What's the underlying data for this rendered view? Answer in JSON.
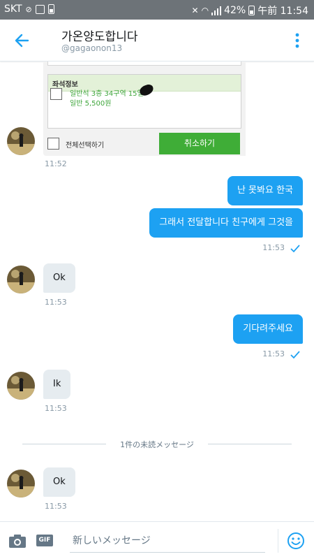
{
  "status_bar": {
    "carrier": "SKT",
    "battery": "42%",
    "time": "午前 11:54"
  },
  "header": {
    "title": "가온양도합니다",
    "handle": "@gagaonon13"
  },
  "shared_image": {
    "section_title": "좌석정보",
    "seat_line1": "일반석 3층 34구역 15열",
    "seat_line2": "일반 5,500원",
    "select_all_label": "전체선택하기",
    "cancel_label": "취소하기"
  },
  "messages": [
    {
      "from": "them",
      "time": "11:52"
    },
    {
      "from": "me",
      "text": "난 못봐요 한국"
    },
    {
      "from": "me",
      "text": "그래서 전달합니다 친구에게 그것을",
      "time": "11:53"
    },
    {
      "from": "them",
      "text": "Ok",
      "time": "11:53"
    },
    {
      "from": "me",
      "text": "기다려주세요",
      "time": "11:53"
    },
    {
      "from": "them",
      "text": "Ik",
      "time": "11:53"
    },
    {
      "from": "them",
      "text": "Ok",
      "time": "11:53"
    }
  ],
  "unread_divider": "1件の未読メッセージ",
  "composer": {
    "placeholder": "新しいメッセージ",
    "gif_label": "GIF"
  },
  "colors": {
    "accent": "#1da1f2",
    "incoming_bubble": "#e6ecf0",
    "status_bar": "#6d7378",
    "cancel_button": "#3fad37"
  }
}
